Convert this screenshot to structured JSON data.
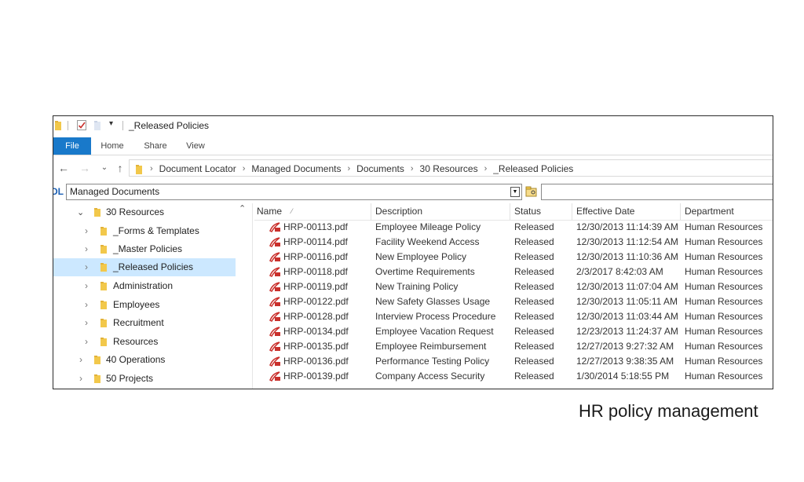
{
  "window": {
    "title": "_Released Policies"
  },
  "ribbon": {
    "tabs": [
      "File",
      "Home",
      "Share",
      "View"
    ]
  },
  "address": {
    "breadcrumbs": [
      "Document Locator",
      "Managed Documents",
      "Documents",
      "30 Resources",
      "_Released Policies"
    ]
  },
  "locator": {
    "badge": "DL",
    "selected": "Managed Documents",
    "search_value": ""
  },
  "tree": [
    {
      "label": "30 Resources",
      "expanded": true
    },
    {
      "label": "_Forms & Templates"
    },
    {
      "label": "_Master Policies"
    },
    {
      "label": "_Released Policies",
      "selected": true
    },
    {
      "label": "Administration"
    },
    {
      "label": "Employees"
    },
    {
      "label": "Recruitment"
    },
    {
      "label": "Resources"
    },
    {
      "label": "40 Operations"
    },
    {
      "label": "50 Projects"
    }
  ],
  "table": {
    "columns": [
      "Name",
      "Description",
      "Status",
      "Effective Date",
      "Department"
    ],
    "rows": [
      [
        "HRP-00113.pdf",
        "Employee Mileage Policy",
        "Released",
        "12/30/2013 11:14:39 AM",
        "Human Resources"
      ],
      [
        "HRP-00114.pdf",
        "Facility Weekend Access",
        "Released",
        "12/30/2013 11:12:54 AM",
        "Human Resources"
      ],
      [
        "HRP-00116.pdf",
        "New Employee Policy",
        "Released",
        "12/30/2013 11:10:36 AM",
        "Human Resources"
      ],
      [
        "HRP-00118.pdf",
        "Overtime Requirements",
        "Released",
        "2/3/2017 8:42:03 AM",
        "Human Resources"
      ],
      [
        "HRP-00119.pdf",
        "New Training Policy",
        "Released",
        "12/30/2013 11:07:04 AM",
        "Human Resources"
      ],
      [
        "HRP-00122.pdf",
        "New Safety Glasses Usage",
        "Released",
        "12/30/2013 11:05:11 AM",
        "Human Resources"
      ],
      [
        "HRP-00128.pdf",
        "Interview Process Procedure",
        "Released",
        "12/30/2013 11:03:44 AM",
        "Human Resources"
      ],
      [
        "HRP-00134.pdf",
        "Employee Vacation Request",
        "Released",
        "12/23/2013 11:24:37 AM",
        "Human Resources"
      ],
      [
        "HRP-00135.pdf",
        "Employee Reimbursement",
        "Released",
        "12/27/2013 9:27:32 AM",
        "Human Resources"
      ],
      [
        "HRP-00136.pdf",
        "Performance Testing Policy",
        "Released",
        "12/27/2013 9:38:35 AM",
        "Human Resources"
      ],
      [
        "HRP-00139.pdf",
        "Company Access Security",
        "Released",
        "1/30/2014 5:18:55 PM",
        "Human Resources"
      ]
    ]
  },
  "caption": "HR policy management",
  "colors": {
    "accent": "#1979ca",
    "selection": "#cce8ff",
    "folder": "#f2c84b",
    "pdf": "#c9302c"
  }
}
